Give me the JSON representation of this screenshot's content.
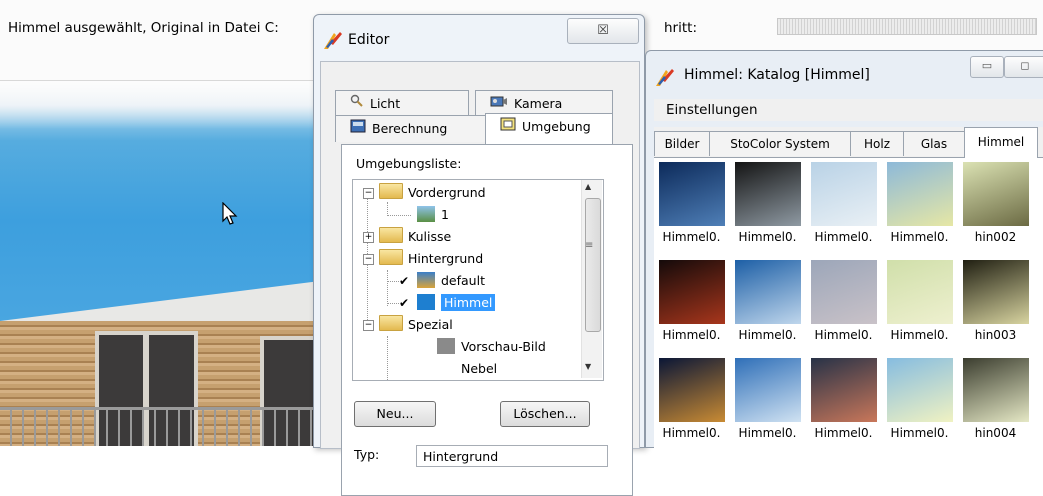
{
  "statusbar": {
    "message": "Himmel ausgewählt, Original in Datei C:",
    "progress_label": "hritt:"
  },
  "editor": {
    "title": "Editor",
    "close_label": "☒",
    "tabs": {
      "licht": "Licht",
      "kamera": "Kamera",
      "berechnung": "Berechnung",
      "umgebung": "Umgebung"
    },
    "env_list_label": "Umgebungsliste:",
    "tree": {
      "vordergrund": "Vordergrund",
      "vordergrund_child": "1",
      "kulisse": "Kulisse",
      "hintergrund": "Hintergrund",
      "default": "default",
      "himmel": "Himmel",
      "spezial": "Spezial",
      "vorschau": "Vorschau-Bild",
      "nebel": "Nebel"
    },
    "buttons": {
      "new": "Neu...",
      "delete": "Löschen..."
    },
    "type_label": "Typ:",
    "type_value": "Hintergrund"
  },
  "catalog": {
    "title": "Himmel: Katalog  [Himmel]",
    "menu_settings": "Einstellungen",
    "tabs": {
      "bilder": "Bilder",
      "stocolor": "StoColor System",
      "holz": "Holz",
      "glas": "Glas",
      "himmel": "Himmel"
    },
    "items": [
      {
        "label": "Himmel0.",
        "colors": [
          "#0c2a5a",
          "#4f7fb7"
        ]
      },
      {
        "label": "Himmel0.",
        "colors": [
          "#141414",
          "#8f9aa3"
        ]
      },
      {
        "label": "Himmel0.",
        "colors": [
          "#b9d2e6",
          "#e9f0f5"
        ]
      },
      {
        "label": "Himmel0.",
        "colors": [
          "#8db9d9",
          "#e6e7a5"
        ]
      },
      {
        "label": "hin002",
        "colors": [
          "#dbe2b3",
          "#6b6a43"
        ]
      },
      {
        "label": "Himmel0.",
        "colors": [
          "#140a0a",
          "#a8361c"
        ]
      },
      {
        "label": "Himmel0.",
        "colors": [
          "#1d5fa6",
          "#bfd6ec"
        ]
      },
      {
        "label": "Himmel0.",
        "colors": [
          "#9ca6b9",
          "#c9c2c8"
        ]
      },
      {
        "label": "Himmel0.",
        "colors": [
          "#d0dfaa",
          "#eef0cf"
        ]
      },
      {
        "label": "hin003",
        "colors": [
          "#201f12",
          "#d8d4a0"
        ]
      },
      {
        "label": "Himmel0.",
        "colors": [
          "#0a1636",
          "#c98b34"
        ]
      },
      {
        "label": "Himmel0.",
        "colors": [
          "#2f6fb8",
          "#d0e2f2"
        ]
      },
      {
        "label": "Himmel0.",
        "colors": [
          "#273247",
          "#c9775a"
        ]
      },
      {
        "label": "Himmel0.",
        "colors": [
          "#86bce0",
          "#f0f2c2"
        ]
      },
      {
        "label": "hin004",
        "colors": [
          "#3b3d2f",
          "#e5e8c5"
        ]
      }
    ]
  }
}
